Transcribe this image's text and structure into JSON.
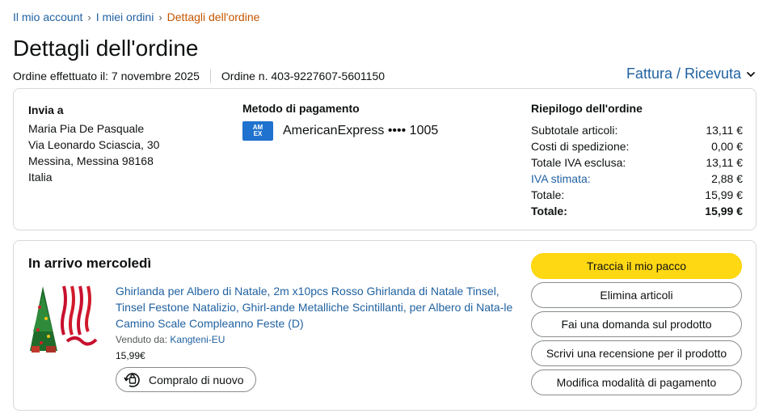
{
  "breadcrumb": {
    "items": [
      "Il mio account",
      "I miei ordini"
    ],
    "separator": "›",
    "current": "Dettagli dell'ordine"
  },
  "page": {
    "title": "Dettagli dell'ordine",
    "order_date": "Ordine effettuato il: 7 novembre 2025",
    "order_number": "Ordine n. 403-9227607-5601150",
    "invoice_link": "Fattura / Ricevuta"
  },
  "shipping": {
    "title": "Invia a",
    "name": "Maria Pia De Pasquale",
    "street": "Via Leonardo Sciascia, 30",
    "city": "Messina, Messina 98168",
    "country": "Italia"
  },
  "payment": {
    "title": "Metodo di pagamento",
    "card_logo_line1": "AM",
    "card_logo_line2": "EX",
    "card_text": "AmericanExpress •••• 1005"
  },
  "summary": {
    "title": "Riepilogo dell'ordine",
    "rows": [
      {
        "label": "Subtotale articoli:",
        "value": "13,11 €"
      },
      {
        "label": "Costi di spedizione:",
        "value": "0,00 €"
      },
      {
        "label": "Totale IVA esclusa:",
        "value": "13,11 €"
      },
      {
        "label": "IVA stimata:",
        "value": "2,88 €"
      },
      {
        "label": "Totale:",
        "value": "15,99 €"
      },
      {
        "label": "Totale:",
        "value": "15,99 €"
      }
    ]
  },
  "delivery": {
    "title": "In arrivo mercoledì",
    "product_title": "Ghirlanda per Albero di Natale, 2m x10pcs Rosso Ghirlanda di Natale Tinsel, Tinsel Festone Natalizio, Ghirl-ande Metalliche Scintillanti, per Albero di Nata-le Camino Scale Compleanno Feste (D)",
    "seller_label": "Venduto da:",
    "seller_name": "Kangteni-EU",
    "price": "15,99€",
    "buy_again": "Compralo di nuovo"
  },
  "actions": {
    "track": "Traccia il mio pacco",
    "delete": "Elimina articoli",
    "question": "Fai una domanda sul prodotto",
    "review": "Scrivi una recensione per il prodotto",
    "change_payment": "Modifica modalità di pagamento"
  },
  "colors": {
    "link": "#2162a1",
    "breadcrumb_current": "#c45500",
    "primary_button": "#ffd814",
    "amex_blue": "#1f72cd"
  },
  "icons": {
    "dropdown": "chevron-down-icon",
    "buy_again": "shopping-bag-refresh-icon",
    "card": "american-express-card-icon"
  }
}
